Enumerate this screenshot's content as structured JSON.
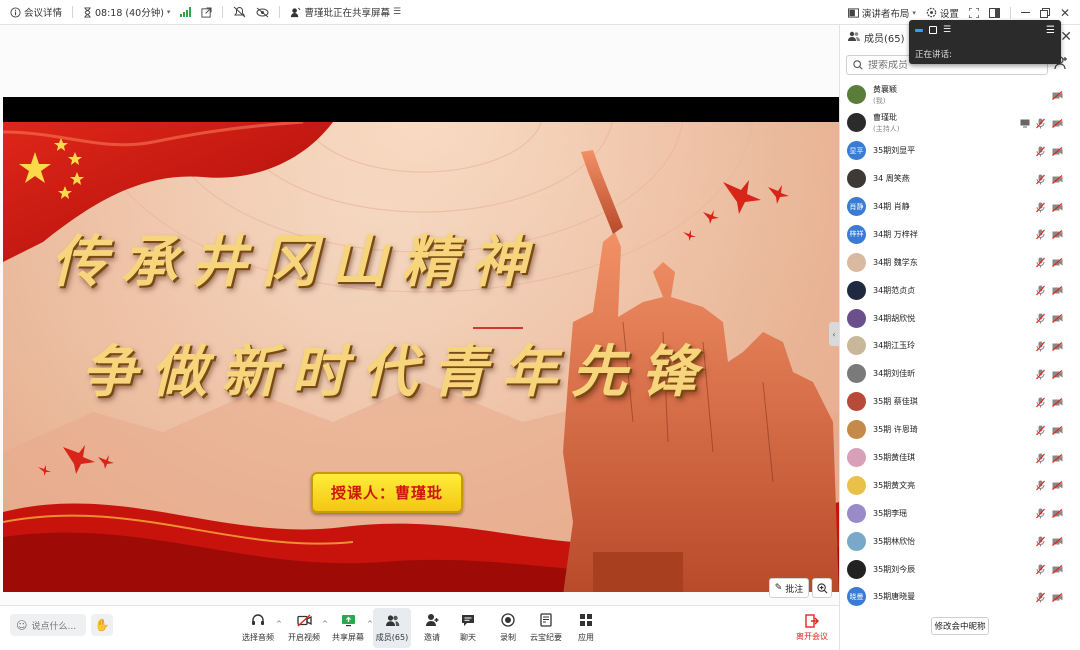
{
  "topbar": {
    "meeting_info": "会议详情",
    "timer": "08:18 (40分钟)",
    "sharing_status": "曹瑾玭正在共享屏幕",
    "layout_label": "演讲者布局",
    "settings_label": "设置"
  },
  "slide": {
    "title_line1": "传承井冈山精神",
    "title_line2": "争做新时代青年先锋",
    "lecturer_label": "授课人：曹瑾玭"
  },
  "annotation": {
    "annotate_label": "批注"
  },
  "panel": {
    "header": "成员(65)",
    "search_placeholder": "搜索成员",
    "rename_label": "修改会中昵称",
    "members": [
      {
        "name": "黄襄颖",
        "sub": "(我)",
        "avatar_text": "",
        "avatar_color": "#5a7d3a",
        "presenter": false,
        "mic": "muted"
      },
      {
        "name": "曹瑾玭",
        "sub": "(主持人)",
        "avatar_text": "",
        "avatar_color": "#2b2b2b",
        "presenter": true,
        "mic": "muted"
      },
      {
        "name": "35期刘显平",
        "sub": "",
        "avatar_text": "显平",
        "avatar_color": "#3a7bd5",
        "presenter": false,
        "mic": "muted"
      },
      {
        "name": "34 周笑燕",
        "sub": "",
        "avatar_text": "",
        "avatar_color": "#3d3a35",
        "presenter": false,
        "mic": "muted"
      },
      {
        "name": "34期  肖静",
        "sub": "",
        "avatar_text": "肖静",
        "avatar_color": "#3a7bd5",
        "presenter": false,
        "mic": "muted"
      },
      {
        "name": "34期 万梓祥",
        "sub": "",
        "avatar_text": "梓祥",
        "avatar_color": "#3a7bd5",
        "presenter": false,
        "mic": "muted"
      },
      {
        "name": "34期 魏学东",
        "sub": "",
        "avatar_text": "",
        "avatar_color": "#d9b9a0",
        "presenter": false,
        "mic": "muted"
      },
      {
        "name": "34期范贞贞",
        "sub": "",
        "avatar_text": "",
        "avatar_color": "#1f2a40",
        "presenter": false,
        "mic": "muted"
      },
      {
        "name": "34期胡欣悦",
        "sub": "",
        "avatar_text": "",
        "avatar_color": "#6a4f8a",
        "presenter": false,
        "mic": "muted"
      },
      {
        "name": "34期江玉玲",
        "sub": "",
        "avatar_text": "",
        "avatar_color": "#c9b79a",
        "presenter": false,
        "mic": "muted"
      },
      {
        "name": "34期刘佳昕",
        "sub": "",
        "avatar_text": "",
        "avatar_color": "#7a7a7a",
        "presenter": false,
        "mic": "muted"
      },
      {
        "name": "35期 蔡佳琪",
        "sub": "",
        "avatar_text": "",
        "avatar_color": "#b84a3a",
        "presenter": false,
        "mic": "muted"
      },
      {
        "name": "35期 许恩琦",
        "sub": "",
        "avatar_text": "",
        "avatar_color": "#c48a4a",
        "presenter": false,
        "mic": "muted"
      },
      {
        "name": "35期黄佳琪",
        "sub": "",
        "avatar_text": "",
        "avatar_color": "#d8a0b8",
        "presenter": false,
        "mic": "muted"
      },
      {
        "name": "35期黄文亮",
        "sub": "",
        "avatar_text": "",
        "avatar_color": "#e8c04a",
        "presenter": false,
        "mic": "muted"
      },
      {
        "name": "35期李瑶",
        "sub": "",
        "avatar_text": "",
        "avatar_color": "#9a8ac8",
        "presenter": false,
        "mic": "muted"
      },
      {
        "name": "35期林欣怡",
        "sub": "",
        "avatar_text": "",
        "avatar_color": "#7aa8c8",
        "presenter": false,
        "mic": "muted"
      },
      {
        "name": "35期刘今辰",
        "sub": "",
        "avatar_text": "",
        "avatar_color": "#222222",
        "presenter": false,
        "mic": "muted"
      },
      {
        "name": "35期唐晓曼",
        "sub": "",
        "avatar_text": "晓曼",
        "avatar_color": "#3a7bd5",
        "presenter": false,
        "mic": "muted"
      }
    ]
  },
  "speaker": {
    "label": "正在讲话:"
  },
  "bottombar": {
    "say_placeholder": "说点什么...",
    "tools": [
      {
        "label": "选择音频",
        "icon": "headset-icon"
      },
      {
        "label": "开启视频",
        "icon": "video-off-icon"
      },
      {
        "label": "共享屏幕",
        "icon": "share-screen-icon"
      },
      {
        "label": "成员(65)",
        "icon": "members-icon"
      },
      {
        "label": "邀请",
        "icon": "invite-icon"
      },
      {
        "label": "聊天",
        "icon": "chat-icon"
      },
      {
        "label": "录制",
        "icon": "record-icon"
      },
      {
        "label": "云宝纪要",
        "icon": "notes-icon"
      },
      {
        "label": "应用",
        "icon": "apps-icon"
      }
    ],
    "leave_label": "离开会议"
  },
  "colors": {
    "accent_blue": "#3a7bd5",
    "leave_red": "#e0261f",
    "slide_red": "#c8120c",
    "title_gold": "#f6d57c"
  }
}
